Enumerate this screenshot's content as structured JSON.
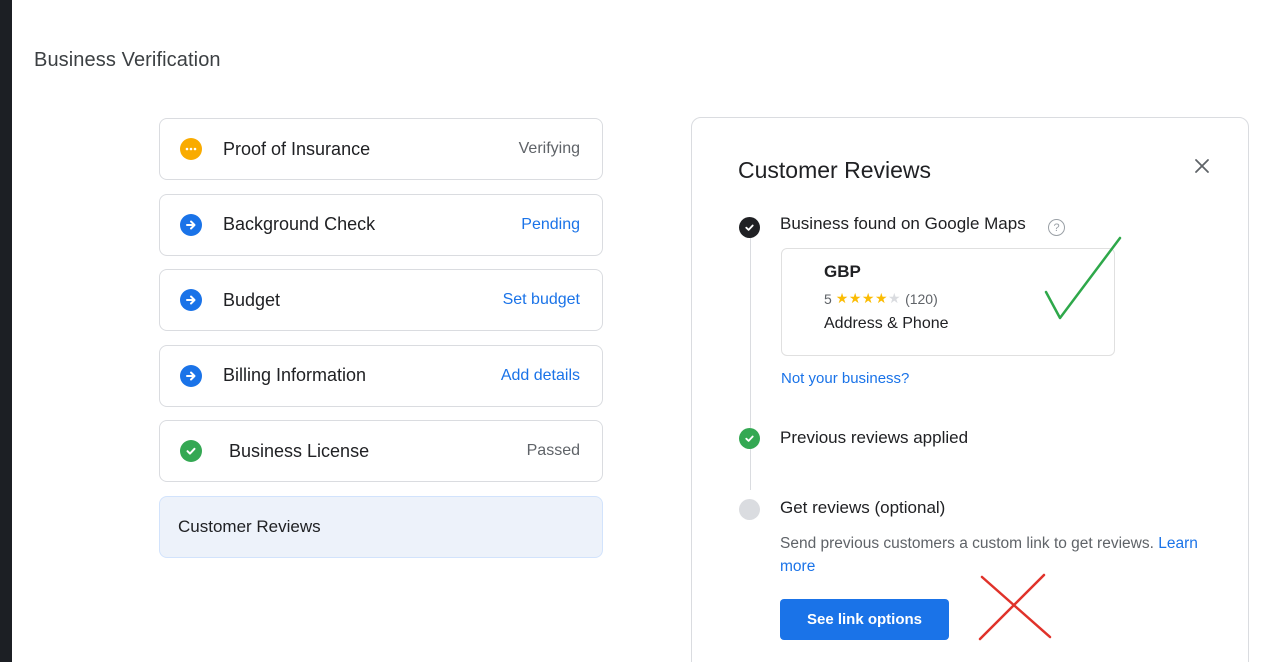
{
  "page": {
    "title": "Business Verification"
  },
  "steps": [
    {
      "label": "Proof of Insurance",
      "status": "Verifying",
      "icon": "pending-dots-icon"
    },
    {
      "label": "Background Check",
      "status": "Pending",
      "icon": "arrow-right-circle-icon"
    },
    {
      "label": "Budget",
      "status": "Set budget",
      "icon": "arrow-right-circle-icon"
    },
    {
      "label": "Billing Information",
      "status": "Add details",
      "icon": "arrow-right-circle-icon"
    },
    {
      "label": "Business License",
      "status": "Passed",
      "icon": "check-circle-icon"
    },
    {
      "label": "Customer Reviews",
      "status": "",
      "selected": true
    }
  ],
  "panel": {
    "title": "Customer Reviews",
    "close_icon": "close-icon",
    "items": [
      {
        "label": "Business found on Google Maps",
        "state": "done",
        "help_icon": "?"
      },
      {
        "label": "Previous reviews applied",
        "state": "passed"
      },
      {
        "label": "Get reviews (optional)",
        "state": "todo"
      }
    ],
    "gbp": {
      "name": "GBP",
      "rating": "5",
      "stars": "★★★★",
      "star_empty": "★",
      "stars_filled": 4,
      "stars_total": 5,
      "count": "(120)",
      "address": "Address & Phone"
    },
    "not_business_link": "Not your business?",
    "description": "Send previous customers a custom link to get reviews.",
    "learn_more": "Learn more",
    "button": "See link options"
  },
  "colors": {
    "accent": "#1a73e8",
    "warning": "#f9ab00",
    "success": "#34a853",
    "annotation_check": "#2ea84a",
    "annotation_cross": "#e0322a"
  }
}
